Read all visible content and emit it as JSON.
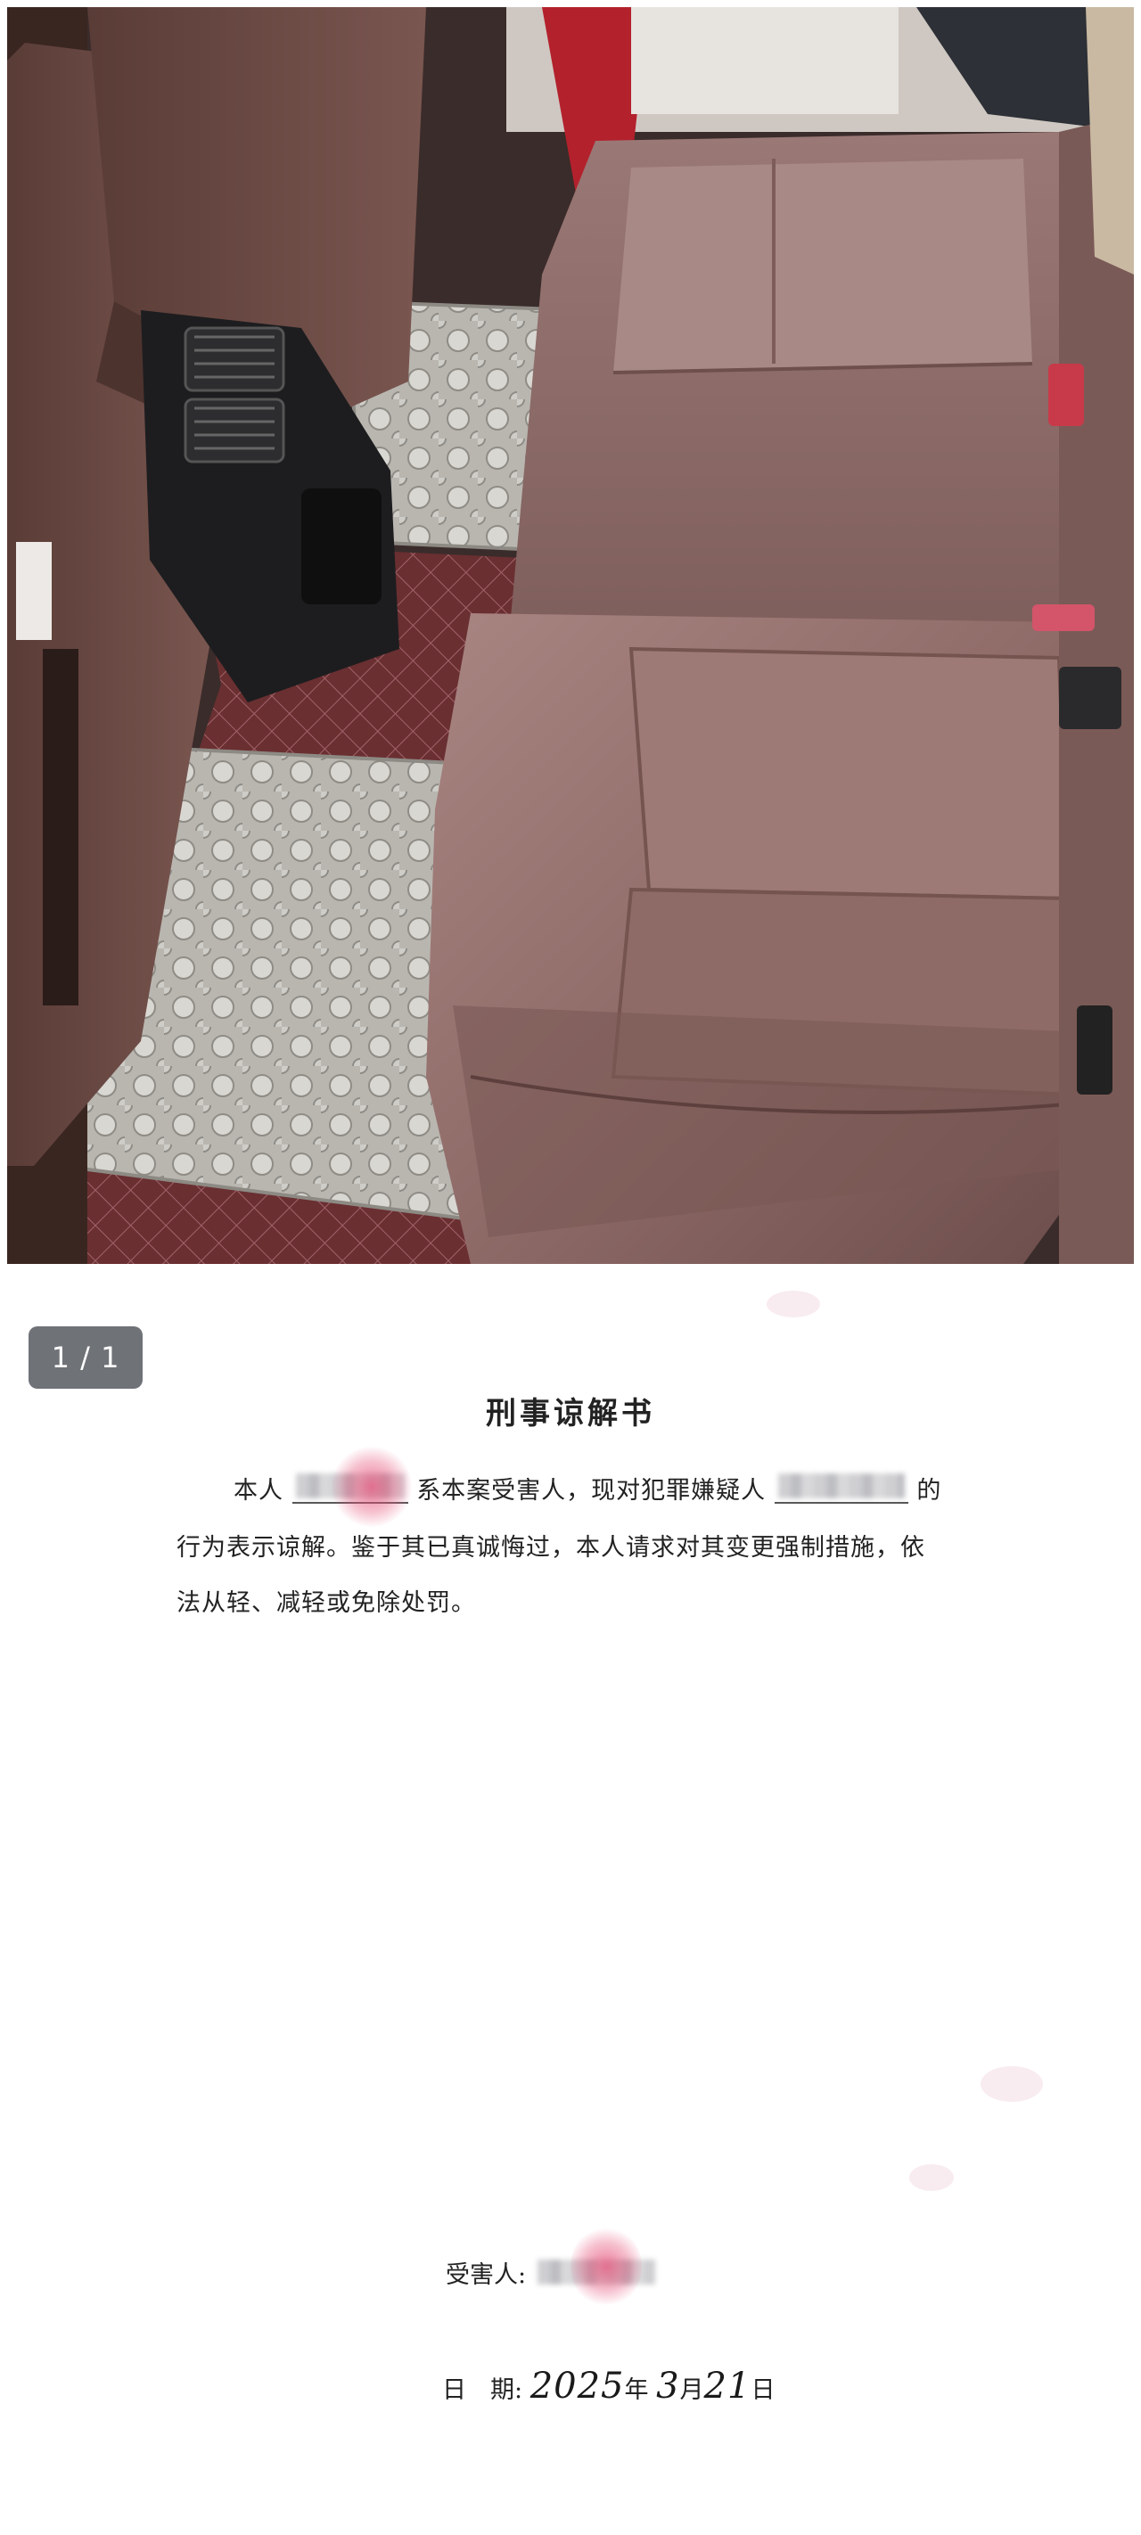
{
  "page_indicator": "1 / 1",
  "document": {
    "title": "刑事谅解书",
    "line1_prefix": "本人",
    "line1_middle": "系本案受害人，现对犯罪嫌疑人",
    "line1_suffix": "的",
    "line2": "行为表示谅解。鉴于其已真诚悔过，本人请求对其变更强制措施，依",
    "line3": "法从轻、减轻或免除处罚。",
    "signature_label": "受害人:",
    "date_label": "日　期:",
    "date_year": "2025",
    "date_year_unit": "年",
    "date_month": "3",
    "date_month_unit": "月",
    "date_day": "21",
    "date_day_unit": "日"
  },
  "colors": {
    "seat_leather": "#8e6a66",
    "badge_bg": "#6f7277",
    "stamp_pink": "#e65078"
  }
}
